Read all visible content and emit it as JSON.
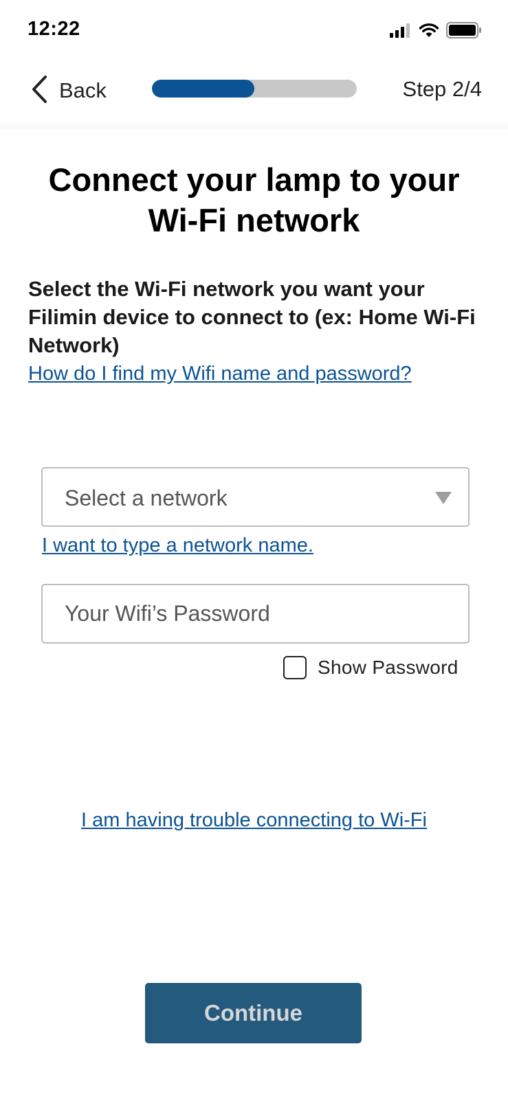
{
  "status_bar": {
    "time": "12:22",
    "icons": [
      "signal-icon",
      "wifi-icon",
      "battery-icon"
    ]
  },
  "header": {
    "back_label": "Back",
    "progress_fraction": 0.5,
    "step_label": "Step 2/4"
  },
  "main": {
    "title": "Connect your lamp to your Wi-Fi network",
    "description": "Select the Wi-Fi network you want your Filimin device to connect to (ex: Home Wi-Fi Network)",
    "help_link": "How do I find my Wifi name and password?",
    "network_select_placeholder": "Select a network",
    "type_network_link": "I want to type a network name.",
    "password_placeholder": "Your Wifi’s Password",
    "show_password_label": "Show Password",
    "show_password_checked": false,
    "trouble_link": "I am having trouble connecting to Wi-Fi",
    "continue_label": "Continue"
  },
  "colors": {
    "accent": "#0b5394",
    "progress_track": "#c8c8c8",
    "button_background": "#245a7e",
    "button_text": "#d7d7d7"
  }
}
